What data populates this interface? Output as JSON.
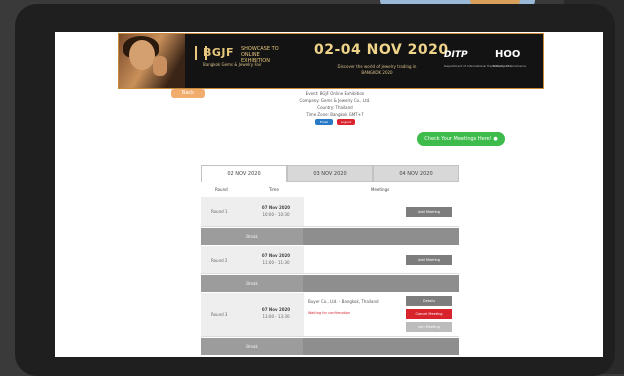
{
  "banner": {
    "logo_text": "BGJF",
    "logo_sub": "Bangkok Gems & Jewelry Fair",
    "tagline": "SHOWCASE TO ONLINE EXHIBITION",
    "date": "02-04 NOV 2020",
    "description": "Discover the world of jewelry trading in BANGKOK 2020",
    "partner1": "DITP",
    "partner1_sub": "Department of International Trade Promotion",
    "partner2": "HOO",
    "partner2_sub": "Ministry of Commerce"
  },
  "back_button": "Back",
  "info": {
    "line1": "Event: BGJF Online Exhibition",
    "line2": "Company: Gems & Jewelry Co., Ltd.",
    "line3": "Country: Thailand",
    "line4": "Time Zone: Bangkok GMT+7",
    "pill_blue": "Email",
    "pill_red": "Logout"
  },
  "green_button": "Check Your Meetings Here!",
  "tabs": [
    "02 NOV 2020",
    "03 NOV 2020",
    "04 NOV 2020"
  ],
  "table_header": {
    "round": "Round",
    "time": "Time",
    "meetings": "Meetings"
  },
  "rows": [
    {
      "label": "Round 1",
      "time1": "07 Nov 2020",
      "time2": "10:00 - 10:30",
      "action": "Add Meeting"
    },
    {
      "break": "Break"
    },
    {
      "label": "Round 2",
      "time1": "07 Nov 2020",
      "time2": "11:00 - 11:30",
      "action": "Add Meeting"
    },
    {
      "break": "Break"
    },
    {
      "label": "Round 3",
      "time1": "07 Nov 2020",
      "time2": "13:00 - 13:30",
      "company": "Buyer Co., Ltd. - Bangkok, Thailand",
      "status": "Waiting for confirmation",
      "btn1": "Details",
      "btn2": "Cancel Meeting",
      "btn3": "Join Meeting"
    },
    {
      "break": "Break"
    }
  ],
  "colors": {
    "green": "#3dbb4b",
    "red": "#d8232c",
    "blue": "#2979c9",
    "orange": "#f0ad6e",
    "gold": "#e6c77c"
  }
}
